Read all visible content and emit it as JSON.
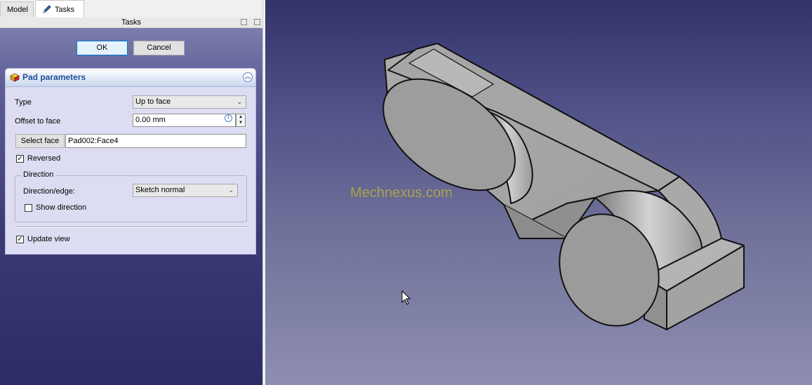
{
  "tabs": {
    "model": "Model",
    "tasks": "Tasks"
  },
  "dock_title": "Tasks",
  "buttons": {
    "ok": "OK",
    "cancel": "Cancel"
  },
  "panel": {
    "title": "Pad parameters",
    "type_label": "Type",
    "type_value": "Up to face",
    "offset_label": "Offset to face",
    "offset_value": "0.00 mm",
    "select_face_label": "Select face",
    "face_value": "Pad002:Face4",
    "reversed_label": "Reversed",
    "reversed_checked": true,
    "direction_group": "Direction",
    "direction_edge_label": "Direction/edge:",
    "direction_edge_value": "Sketch normal",
    "show_direction_label": "Show direction",
    "show_direction_checked": false,
    "update_view_label": "Update view",
    "update_view_checked": true
  },
  "viewport": {
    "watermark": "Mechnexus.com"
  },
  "colors": {
    "accent": "#0078d7",
    "panel_title": "#1f4f9c",
    "watermark": "#a9a34e"
  }
}
